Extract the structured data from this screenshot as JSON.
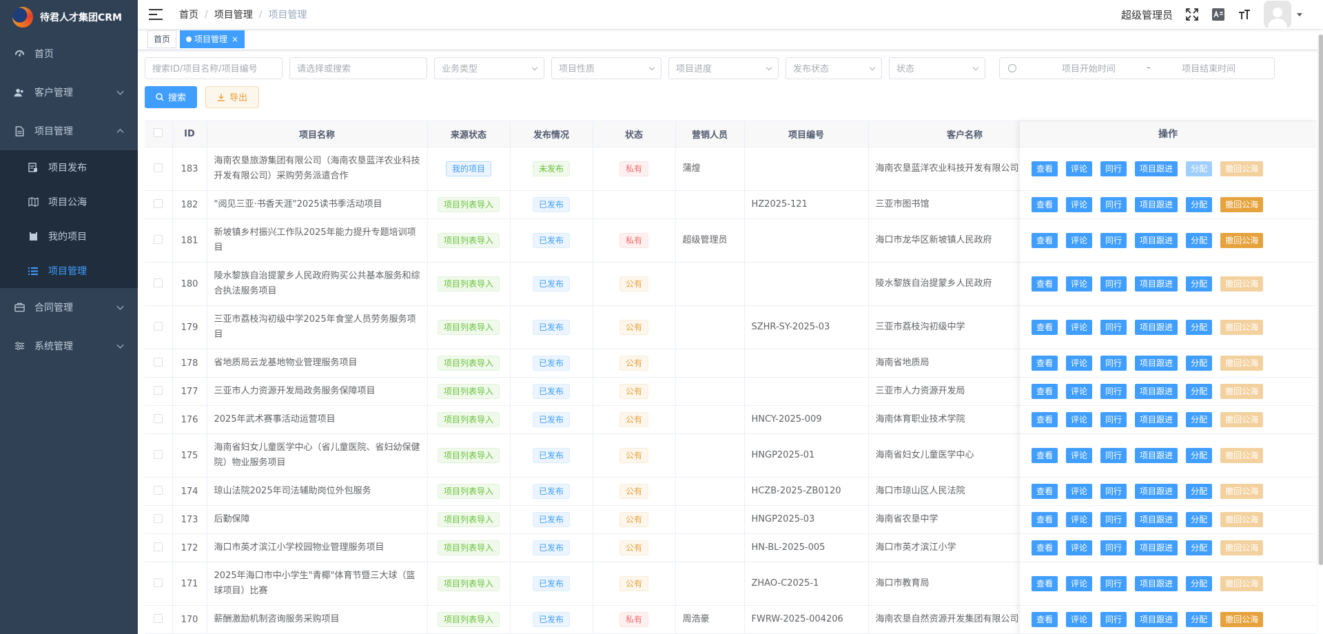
{
  "app": {
    "title": "待君人才集团CRM"
  },
  "sidebar": {
    "items": [
      {
        "label": "首页",
        "icon": "dashboard-icon"
      },
      {
        "label": "客户管理",
        "icon": "users-icon"
      },
      {
        "label": "项目管理",
        "icon": "document-icon"
      },
      {
        "label": "合同管理",
        "icon": "briefcase-icon"
      },
      {
        "label": "系统管理",
        "icon": "sliders-icon"
      }
    ],
    "sub": [
      {
        "label": "项目发布"
      },
      {
        "label": "项目公海"
      },
      {
        "label": "我的项目"
      },
      {
        "label": "项目管理"
      }
    ]
  },
  "navbar": {
    "breadcrumb": [
      "首页",
      "项目管理",
      "项目管理"
    ],
    "username": "超级管理员"
  },
  "tags": {
    "home": "首页",
    "current": "项目管理"
  },
  "filters": {
    "search_placeholder": "搜索ID/项目名称/项目编号",
    "select_placeholder": "请选择或搜索",
    "business_type": "业务类型",
    "nature": "项目性质",
    "progress": "项目进度",
    "publish_status": "发布状态",
    "status": "状态",
    "start_time": "项目开始时间",
    "range_sep": "-",
    "end_time": "项目结束时间",
    "search_btn": "搜索",
    "export_btn": "导出"
  },
  "table": {
    "headers": {
      "id": "ID",
      "name": "项目名称",
      "source": "来源状态",
      "publish": "发布情况",
      "status": "状态",
      "sales": "营销人员",
      "code": "项目编号",
      "customer": "客户名称",
      "ops": "操作"
    },
    "ops_labels": {
      "view": "查看",
      "comment": "评论",
      "peer": "同行",
      "follow": "项目跟进",
      "assign": "分配",
      "recall": "撤回公海"
    },
    "rows": [
      {
        "id": "183",
        "name": "海南农垦旅游集团有限公司（海南农垦蓝洋农业科技开发有限公司）采购劳务派遣合作",
        "source": "我的项目",
        "publish": "未发布",
        "status": "私有",
        "sales": "蒲煌",
        "code": "",
        "customer": "海南农垦蓝洋农业科技开发有限公司"
      },
      {
        "id": "182",
        "name": "\"阅见三亚·书香天涯\"2025读书季活动项目",
        "source": "项目列表导入",
        "publish": "已发布",
        "status": "",
        "sales": "",
        "code": "HZ2025-121",
        "customer": "三亚市图书馆"
      },
      {
        "id": "181",
        "name": "新坡镇乡村振兴工作队2025年能力提升专题培训项目",
        "source": "项目列表导入",
        "publish": "已发布",
        "status": "私有",
        "sales": "超级管理员",
        "code": "",
        "customer": "海口市龙华区新坡镇人民政府"
      },
      {
        "id": "180",
        "name": "陵水黎族自治提蒙乡人民政府购买公共基本服务和综合执法服务项目",
        "source": "项目列表导入",
        "publish": "已发布",
        "status": "公有",
        "sales": "",
        "code": "",
        "customer": "陵水黎族自治提蒙乡人民政府"
      },
      {
        "id": "179",
        "name": "三亚市荔枝沟初级中学2025年食堂人员劳务服务项目",
        "source": "项目列表导入",
        "publish": "已发布",
        "status": "公有",
        "sales": "",
        "code": "SZHR-SY-2025-03",
        "customer": "三亚市荔枝沟初级中学"
      },
      {
        "id": "178",
        "name": "省地质局云龙基地物业管理服务项目",
        "source": "项目列表导入",
        "publish": "已发布",
        "status": "公有",
        "sales": "",
        "code": "",
        "customer": "海南省地质局"
      },
      {
        "id": "177",
        "name": "三亚市人力资源开发局政务服务保障项目",
        "source": "项目列表导入",
        "publish": "已发布",
        "status": "公有",
        "sales": "",
        "code": "",
        "customer": "三亚市人力资源开发局"
      },
      {
        "id": "176",
        "name": "2025年武术赛事活动运营项目",
        "source": "项目列表导入",
        "publish": "已发布",
        "status": "公有",
        "sales": "",
        "code": "HNCY-2025-009",
        "customer": "海南体育职业技术学院"
      },
      {
        "id": "175",
        "name": "海南省妇女儿童医学中心（省儿童医院、省妇幼保健院）物业服务项目",
        "source": "项目列表导入",
        "publish": "已发布",
        "status": "公有",
        "sales": "",
        "code": "HNGP2025-01",
        "customer": "海南省妇女儿童医学中心"
      },
      {
        "id": "174",
        "name": "琼山法院2025年司法辅助岗位外包服务",
        "source": "项目列表导入",
        "publish": "已发布",
        "status": "公有",
        "sales": "",
        "code": "HCZB-2025-ZB0120",
        "customer": "海口市琼山区人民法院"
      },
      {
        "id": "173",
        "name": "后勤保障",
        "source": "项目列表导入",
        "publish": "已发布",
        "status": "公有",
        "sales": "",
        "code": "HNGP2025-03",
        "customer": "海南省农垦中学"
      },
      {
        "id": "172",
        "name": "海口市英才滨江小学校园物业管理服务项目",
        "source": "项目列表导入",
        "publish": "已发布",
        "status": "公有",
        "sales": "",
        "code": "HN-BL-2025-005",
        "customer": "海口市英才滨江小学"
      },
      {
        "id": "171",
        "name": "2025年海口市中小学生\"青椰\"体育节暨三大球（篮球项目）比赛",
        "source": "项目列表导入",
        "publish": "已发布",
        "status": "公有",
        "sales": "",
        "code": "ZHAO-C2025-1",
        "customer": "海口市教育局"
      },
      {
        "id": "170",
        "name": "薪酬激励机制咨询服务采购项目",
        "source": "项目列表导入",
        "publish": "已发布",
        "status": "私有",
        "sales": "周浩豪",
        "code": "FWRW-2025-004206",
        "customer": "海南农垦自然资源开发集团有限公司"
      }
    ]
  }
}
